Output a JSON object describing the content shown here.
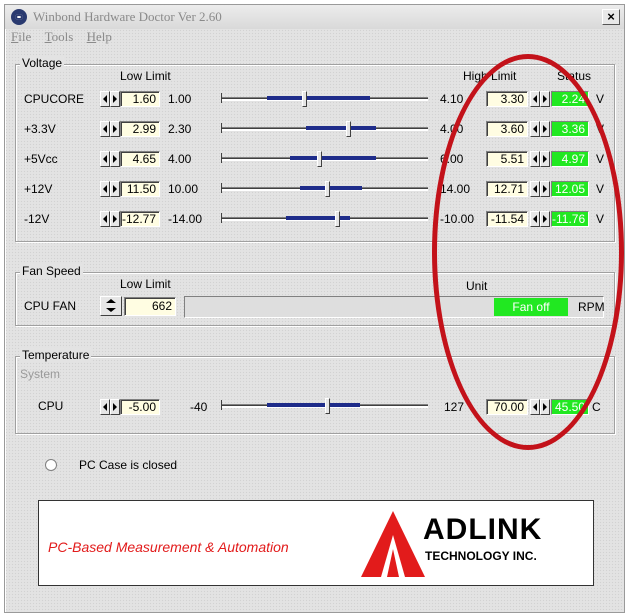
{
  "window": {
    "title": "Winbond Hardware Doctor Ver 2.60",
    "close_label": "×"
  },
  "menu": [
    {
      "mnemonic": "F",
      "rest": "ile"
    },
    {
      "mnemonic": "T",
      "rest": "ools"
    },
    {
      "mnemonic": "H",
      "rest": "elp"
    }
  ],
  "voltage": {
    "group_label": "Voltage",
    "low_limit_header": "Low Limit",
    "high_limit_header": "High Limit",
    "status_header": "Status",
    "unit": "V",
    "rows": [
      {
        "name": "CPUCORE",
        "low_value": "1.60",
        "min": "1.00",
        "max": "4.10",
        "high_value": "3.30",
        "status": "2.24",
        "range_start": 0.22,
        "range_end": 0.72,
        "thumb": 0.4
      },
      {
        "name": "+3.3V",
        "low_value": "2.99",
        "min": "2.30",
        "max": "4.00",
        "high_value": "3.60",
        "status": "3.36",
        "range_start": 0.41,
        "range_end": 0.75,
        "thumb": 0.61
      },
      {
        "name": "+5Vcc",
        "low_value": "4.65",
        "min": "4.00",
        "max": "6.00",
        "high_value": "5.51",
        "status": "4.97",
        "range_start": 0.33,
        "range_end": 0.75,
        "thumb": 0.47
      },
      {
        "name": "+12V",
        "low_value": "11.50",
        "min": "10.00",
        "max": "14.00",
        "high_value": "12.71",
        "status": "12.05",
        "range_start": 0.38,
        "range_end": 0.68,
        "thumb": 0.51
      },
      {
        "name": "-12V",
        "low_value": "-12.77",
        "min": "-14.00",
        "max": "-10.00",
        "high_value": "-11.54",
        "status": "-11.76",
        "range_start": 0.31,
        "range_end": 0.62,
        "thumb": 0.56
      }
    ]
  },
  "fan": {
    "group_label": "Fan Speed",
    "low_limit_header": "Low Limit",
    "unit_header": "Unit",
    "name": "CPU FAN",
    "low_value": "662",
    "status": "Fan off",
    "unit": "RPM"
  },
  "temperature": {
    "group_label": "Temperature",
    "section": "System",
    "name": "CPU",
    "low_value": "-5.00",
    "min": "-40",
    "max": "127",
    "high_value": "70.00",
    "status": "45.50",
    "unit": "C",
    "range_start": 0.22,
    "range_end": 0.67,
    "thumb": 0.51
  },
  "case": {
    "text": "PC Case is closed"
  },
  "banner": {
    "tagline": "PC-Based Measurement & Automation",
    "brand": "ADLINK",
    "brand_sub": "TECHNOLOGY INC."
  },
  "colors": {
    "status_green": "#21e821",
    "limit_field": "#fffde2",
    "slider_range": "#1e2c8a",
    "annotation_red": "#c3121a",
    "banner_red": "#e21b1b"
  }
}
